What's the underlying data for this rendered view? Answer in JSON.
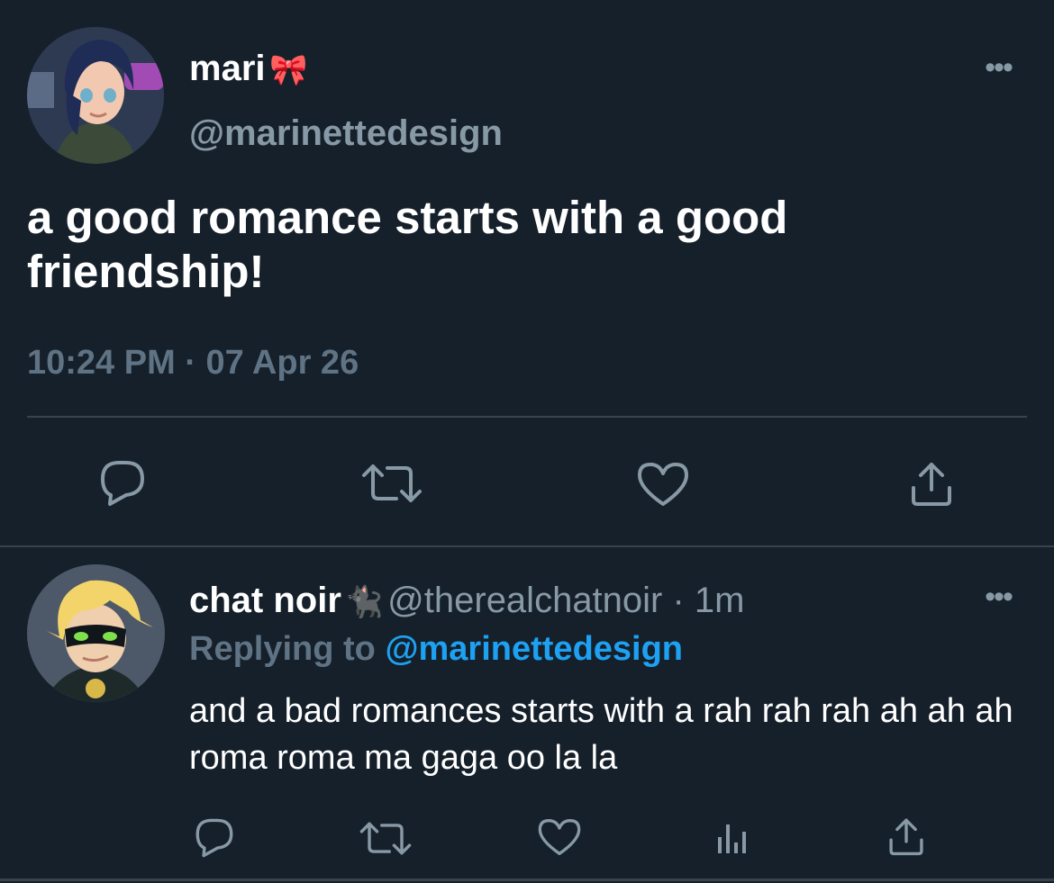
{
  "main_tweet": {
    "display_name": "mari",
    "name_emoji": "🎀",
    "handle": "@marinettedesign",
    "more_label": "•••",
    "text": "a good romance starts with a good friendship!",
    "timestamp": "10:24 PM · 07 Apr 26",
    "actions": [
      {
        "name": "reply",
        "icon": "reply-icon"
      },
      {
        "name": "retweet",
        "icon": "retweet-icon"
      },
      {
        "name": "like",
        "icon": "heart-icon"
      },
      {
        "name": "share",
        "icon": "share-icon"
      }
    ]
  },
  "reply_tweet": {
    "display_name": "chat noir",
    "name_emoji": "🐈‍⬛",
    "handle": "@therealchatnoir",
    "separator": " · ",
    "time_ago": "1m",
    "more_label": "•••",
    "replying_prefix": "Replying to ",
    "replying_to": "@marinettedesign",
    "text": "and a bad romances starts with a rah rah rah ah ah ah roma roma ma gaga oo la la",
    "actions": [
      {
        "name": "reply",
        "icon": "reply-icon"
      },
      {
        "name": "retweet",
        "icon": "retweet-icon"
      },
      {
        "name": "like",
        "icon": "heart-icon"
      },
      {
        "name": "analytics",
        "icon": "analytics-icon"
      },
      {
        "name": "share",
        "icon": "share-icon"
      }
    ]
  },
  "colors": {
    "background": "#15202b",
    "secondary_text": "#8899a6",
    "muted_text": "#5f7384",
    "link": "#1da1f2",
    "divider": "#38444d"
  }
}
